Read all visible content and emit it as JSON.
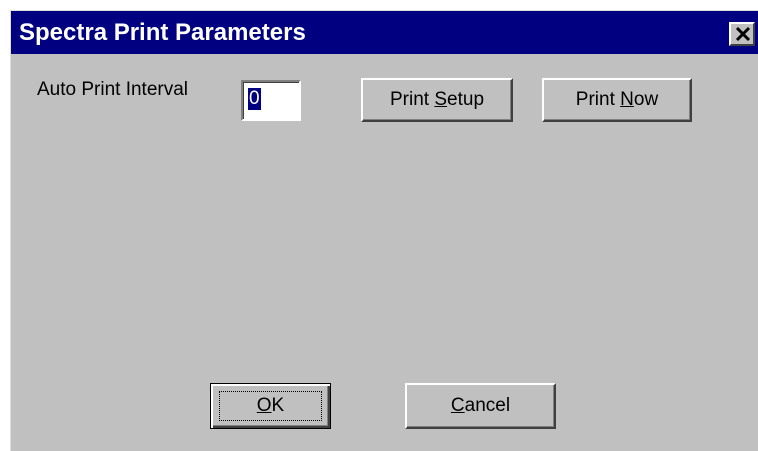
{
  "window": {
    "title": "Spectra Print Parameters",
    "close_icon": "close-x-icon"
  },
  "form": {
    "auto_print_label": "Auto Print Interval",
    "auto_print_value": "0"
  },
  "buttons": {
    "print_setup": {
      "before": "Print ",
      "mnemonic": "S",
      "after": "etup"
    },
    "print_now": {
      "before": "Print ",
      "mnemonic": "N",
      "after": "ow"
    },
    "ok": {
      "before": "",
      "mnemonic": "O",
      "after": "K"
    },
    "cancel": {
      "before": "",
      "mnemonic": "C",
      "after": "ancel"
    }
  },
  "colors": {
    "titlebar": "#000080",
    "face": "#c0c0c0",
    "selection": "#000080"
  }
}
